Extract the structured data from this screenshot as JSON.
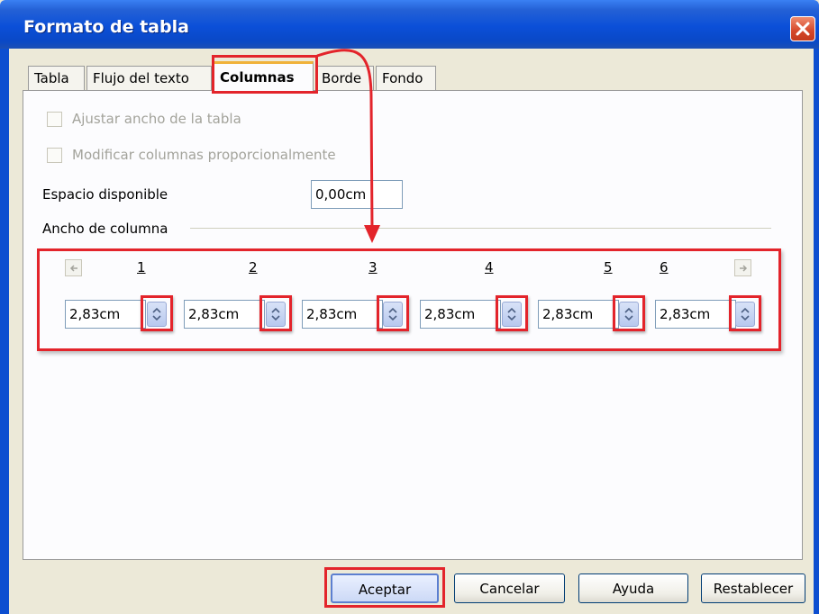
{
  "window": {
    "title": "Formato de tabla"
  },
  "tabs": [
    {
      "label": "Tabla"
    },
    {
      "label": "Flujo del texto"
    },
    {
      "label": "Columnas"
    },
    {
      "label": "Borde"
    },
    {
      "label": "Fondo"
    }
  ],
  "options": {
    "adjust_width_label": "Ajustar ancho de la tabla",
    "adjust_width_checked": false,
    "modify_proportional_label": "Modificar columnas proporcionalmente",
    "modify_proportional_checked": false
  },
  "available_space": {
    "label": "Espacio disponible",
    "value": "0,00cm"
  },
  "column_width": {
    "heading": "Ancho de columna",
    "columns": [
      {
        "number": "1",
        "value": "2,83cm"
      },
      {
        "number": "2",
        "value": "2,83cm"
      },
      {
        "number": "3",
        "value": "2,83cm"
      },
      {
        "number": "4",
        "value": "2,83cm"
      },
      {
        "number": "5",
        "value": "2,83cm"
      },
      {
        "number": "6",
        "value": "2,83cm"
      }
    ]
  },
  "buttons": {
    "ok": "Aceptar",
    "cancel": "Cancelar",
    "help": "Ayuda",
    "reset": "Restablecer"
  },
  "colors": {
    "titlebar": "#0b4fd8",
    "highlight": "#e3242b",
    "active_tab_accent": "#f0b23a",
    "dialog_background": "#ece9d8"
  },
  "icons": [
    "close-icon",
    "arrow-left-icon",
    "arrow-right-icon",
    "spin-icon",
    "annotation-arrow"
  ]
}
